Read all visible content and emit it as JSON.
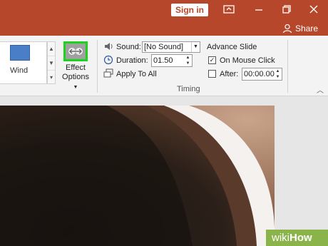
{
  "titlebar": {
    "signin_label": "Sign in"
  },
  "ribbon": {
    "share_label": "Share"
  },
  "transitions": {
    "gallery_item_label": "Wind",
    "effect_options_label_1": "Effect",
    "effect_options_label_2": "Options"
  },
  "timing": {
    "sound_label": "Sound:",
    "sound_value": "[No Sound]",
    "duration_label": "Duration:",
    "duration_value": "01.50",
    "apply_to_all_label": "Apply To All",
    "advance_slide_label": "Advance Slide",
    "on_mouse_click_label": "On Mouse Click",
    "on_mouse_click_checked": true,
    "after_label": "After:",
    "after_checked": false,
    "after_value": "00:00.00",
    "group_label": "Timing"
  },
  "watermark": {
    "wiki": "wiki",
    "how": "How"
  },
  "colors": {
    "accent": "#b7472a",
    "highlight": "#1ad31a"
  }
}
